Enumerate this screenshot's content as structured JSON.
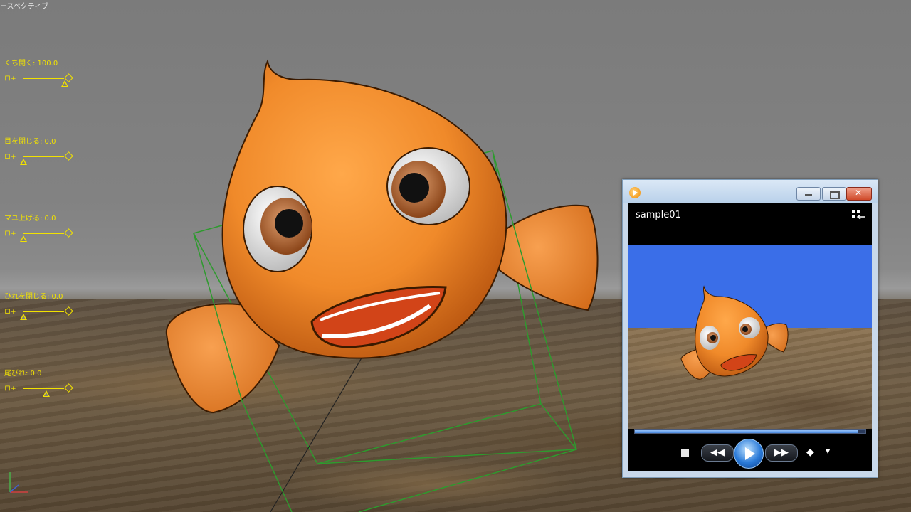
{
  "viewport": {
    "perspective_label": "ースペクティブ"
  },
  "morph_controls": [
    {
      "label": "くち開く: 100.0",
      "prefix": "ロ+",
      "level": 1.0
    },
    {
      "label": "目を閉じる: 0.0",
      "prefix": "ロ+",
      "level": 0.0
    },
    {
      "label": "マユ上げる: 0.0",
      "prefix": "ロ+",
      "level": 0.0
    },
    {
      "label": "ひれを閉じる: 0.0",
      "prefix": "ロ+",
      "level": 0.0
    },
    {
      "label": "尾びれ: 0.0",
      "prefix": "ロ+",
      "level": 0.55
    }
  ],
  "player": {
    "title": "sample01",
    "seek_progress": 0.97,
    "icons": {
      "app": "media-player-icon",
      "minimize": "minimize-icon",
      "maximize": "maximize-icon",
      "close": "close-icon",
      "switch_view": "switch-view-icon",
      "stop": "stop-icon",
      "rewind": "rewind-icon",
      "play": "play-icon",
      "fast_forward": "fast-forward-icon",
      "volume": "volume-icon",
      "volume_dropdown": "chevron-down-icon"
    },
    "glyphs": {
      "rewind": "◀◀",
      "fast_forward": "▶▶",
      "volume": "◆",
      "volume_dropdown": "▼"
    }
  },
  "colors": {
    "fish_orange": "#f08a2a",
    "bounding_box": "#2e9a2e",
    "control_text": "#f2e200",
    "player_sky": "#3a6ee8"
  }
}
